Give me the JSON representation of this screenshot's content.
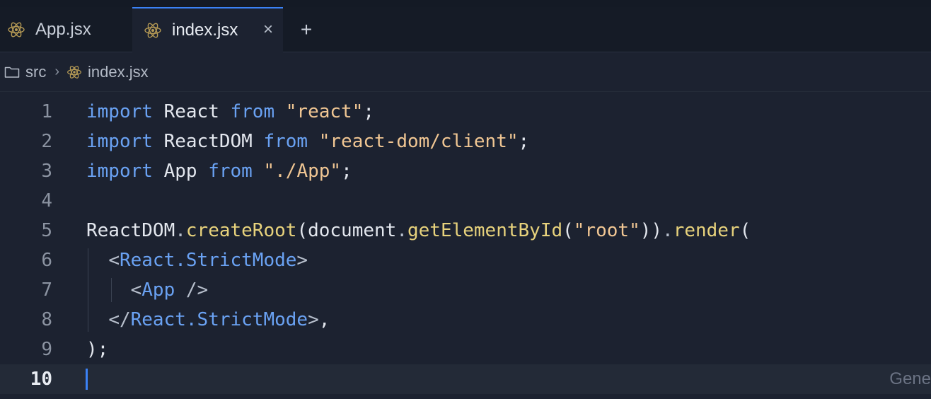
{
  "tabs": [
    {
      "label": "App.jsx",
      "icon": "react-icon",
      "active": false
    },
    {
      "label": "index.jsx",
      "icon": "react-icon",
      "active": true
    }
  ],
  "tab_close_glyph": "×",
  "tab_add_glyph": "+",
  "breadcrumb": {
    "folder": "src",
    "separator": "›",
    "file": "index.jsx"
  },
  "lines": [
    {
      "n": "1",
      "tokens": [
        [
          "kw",
          "import"
        ],
        [
          "plain",
          " React "
        ],
        [
          "kw",
          "from"
        ],
        [
          "plain",
          " "
        ],
        [
          "str",
          "\"react\""
        ],
        [
          "plain",
          ";"
        ]
      ]
    },
    {
      "n": "2",
      "tokens": [
        [
          "kw",
          "import"
        ],
        [
          "plain",
          " ReactDOM "
        ],
        [
          "kw",
          "from"
        ],
        [
          "plain",
          " "
        ],
        [
          "str",
          "\"react-dom/client\""
        ],
        [
          "plain",
          ";"
        ]
      ]
    },
    {
      "n": "3",
      "tokens": [
        [
          "kw",
          "import"
        ],
        [
          "plain",
          " App "
        ],
        [
          "kw",
          "from"
        ],
        [
          "plain",
          " "
        ],
        [
          "str",
          "\"./App\""
        ],
        [
          "plain",
          ";"
        ]
      ]
    },
    {
      "n": "4",
      "tokens": []
    },
    {
      "n": "5",
      "tokens": [
        [
          "plain",
          "ReactDOM"
        ],
        [
          "punc",
          "."
        ],
        [
          "fn",
          "createRoot"
        ],
        [
          "plain",
          "(document"
        ],
        [
          "punc",
          "."
        ],
        [
          "fn",
          "getElementById"
        ],
        [
          "plain",
          "("
        ],
        [
          "str",
          "\"root\""
        ],
        [
          "plain",
          "))"
        ],
        [
          "punc",
          "."
        ],
        [
          "fn",
          "render"
        ],
        [
          "plain",
          "("
        ]
      ]
    },
    {
      "n": "6",
      "tokens": [
        [
          "plain",
          "  "
        ],
        [
          "punc",
          "<"
        ],
        [
          "tag",
          "React.StrictMode"
        ],
        [
          "punc",
          ">"
        ]
      ]
    },
    {
      "n": "7",
      "tokens": [
        [
          "plain",
          "    "
        ],
        [
          "punc",
          "<"
        ],
        [
          "tag",
          "App"
        ],
        [
          "punc",
          " />"
        ]
      ]
    },
    {
      "n": "8",
      "tokens": [
        [
          "plain",
          "  "
        ],
        [
          "punc",
          "</"
        ],
        [
          "tag",
          "React.StrictMode"
        ],
        [
          "punc",
          ">"
        ],
        [
          "plain",
          ","
        ]
      ]
    },
    {
      "n": "9",
      "tokens": [
        [
          "plain",
          ");"
        ]
      ]
    },
    {
      "n": "10",
      "tokens": []
    }
  ],
  "current_line": "10",
  "ghost_text": "Gene",
  "colors": {
    "accent": "#3b82f6",
    "keyword": "#6aa2f3",
    "string": "#f0c693",
    "function": "#e7d27c"
  }
}
